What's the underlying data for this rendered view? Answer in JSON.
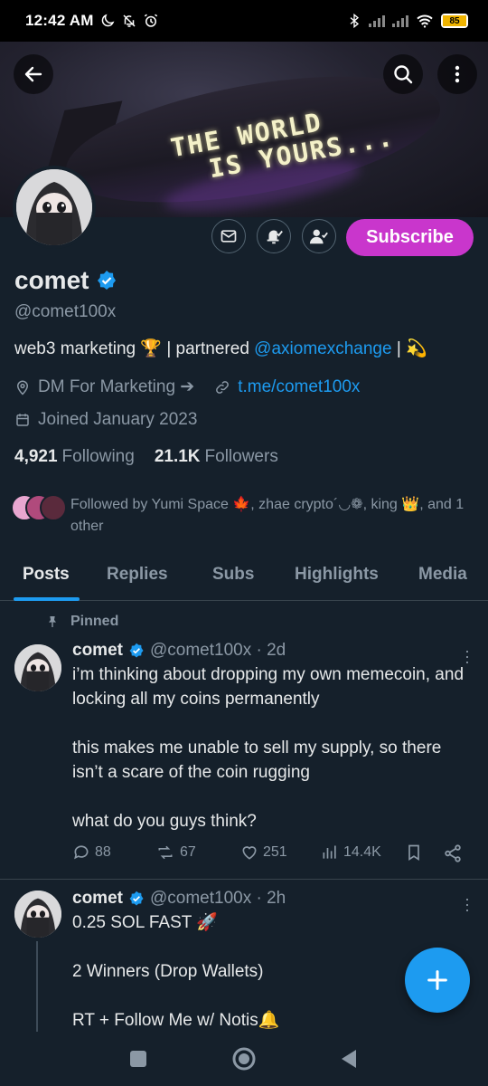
{
  "status_bar": {
    "time": "12:42 AM",
    "battery": "85"
  },
  "banner": {
    "line1": "THE WORLD",
    "line2": "IS YOURS..."
  },
  "profile": {
    "name": "comet",
    "handle": "@comet100x",
    "bio_pre": "web3 marketing 🏆 | partnered ",
    "bio_link": "@axiomexchange",
    "bio_post": " | 💫",
    "location": "DM For Marketing ➔",
    "website": "t.me/comet100x",
    "joined": "Joined January 2023",
    "following_count": "4,921",
    "following_label": "Following",
    "followers_count": "21.1K",
    "followers_label": "Followers",
    "followed_by": "Followed by Yumi Space 🍁, zhae crypto´◡❁, king 👑, and 1 other",
    "subscribe_label": "Subscribe"
  },
  "tabs": [
    {
      "label": "Posts",
      "active": true
    },
    {
      "label": "Replies"
    },
    {
      "label": "Subs"
    },
    {
      "label": "Highlights"
    },
    {
      "label": "Media"
    }
  ],
  "posts": [
    {
      "pinned_label": "Pinned",
      "name": "comet",
      "meta": "@comet100x · 2d",
      "text": "i’m thinking about dropping my own memecoin, and locking all my coins permanently\n\nthis makes me unable to sell my supply, so there isn’t a scare of the coin rugging\n\nwhat do you guys think?",
      "replies": "88",
      "reposts": "67",
      "likes": "251",
      "views": "14.4K"
    },
    {
      "name": "comet",
      "meta": "@comet100x · 2h",
      "text": "0.25 SOL FAST 🚀\n\n2 Winners (Drop Wallets)\n\nRT + Follow Me w/ Notis🔔"
    }
  ],
  "colors": {
    "accent": "#1d9bf0",
    "subscribe": "#c936cc",
    "background": "#15202b"
  }
}
